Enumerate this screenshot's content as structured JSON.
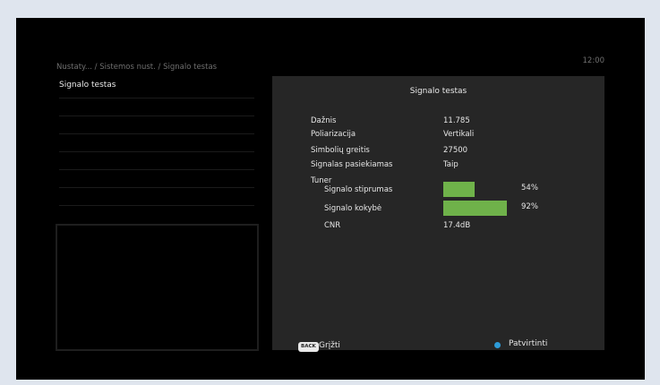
{
  "header": {
    "breadcrumb": "Nustaty... / Sistemos nust.  / Signalo testas",
    "clock": "12:00"
  },
  "sidebar": {
    "items": [
      {
        "label": "Signalo testas",
        "active": true
      },
      {
        "label": ""
      },
      {
        "label": ""
      },
      {
        "label": ""
      },
      {
        "label": ""
      },
      {
        "label": ""
      },
      {
        "label": ""
      },
      {
        "label": ""
      }
    ]
  },
  "panel": {
    "title": "Signalo testas",
    "rows": [
      {
        "label": "Dažnis",
        "value": "11.785"
      },
      {
        "label": "Poliarizacija",
        "value": "Vertikali"
      },
      {
        "label": "Simbolių greitis",
        "value": "27500"
      },
      {
        "label": "Signalas pasiekiamas",
        "value": "Taip"
      }
    ],
    "tuner": {
      "heading": "Tuner",
      "strength": {
        "label": "Signalo stiprumas",
        "percent": 54,
        "percent_text": "54%"
      },
      "quality": {
        "label": "Signalo kokybė",
        "percent": 92,
        "percent_text": "92%"
      },
      "cnr": {
        "label": "CNR",
        "value": "17.4dB"
      }
    }
  },
  "footer": {
    "back_badge": "BACK",
    "back_label": "Grįžti",
    "confirm_label": "Patvirtinti"
  },
  "colors": {
    "bar_green": "#6fb24a",
    "confirm_dot": "#2d9bd8",
    "panel_bg": "#262626"
  },
  "icons": {
    "back": "back-button-icon",
    "confirm": "blue-dot-icon"
  }
}
